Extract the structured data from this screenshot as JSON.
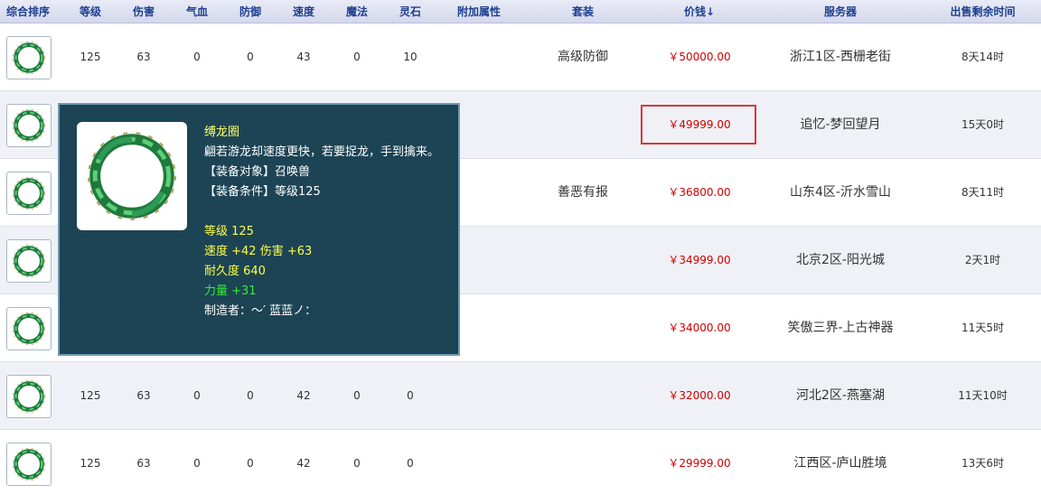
{
  "headers": {
    "sort": "综合排序",
    "level": "等级",
    "damage": "伤害",
    "hp": "气血",
    "defense": "防御",
    "speed": "速度",
    "magic": "魔法",
    "spirit": "灵石",
    "extra": "附加属性",
    "set": "套装",
    "price": "价钱↓",
    "server": "服务器",
    "time": "出售剩余时间"
  },
  "rows": [
    {
      "level": "125",
      "damage": "63",
      "hp": "0",
      "defense": "0",
      "speed": "43",
      "magic": "0",
      "spirit": "10",
      "extra": "",
      "set": "高级防御",
      "price": "￥50000.00",
      "server": "浙江1区-西栅老街",
      "time": "8天14时"
    },
    {
      "level": "",
      "damage": "",
      "hp": "",
      "defense": "",
      "speed": "",
      "magic": "",
      "spirit": "",
      "extra": "",
      "set": "",
      "price": "￥49999.00",
      "server": "追忆-梦回望月",
      "time": "15天0时"
    },
    {
      "level": "",
      "damage": "",
      "hp": "",
      "defense": "",
      "speed": "",
      "magic": "",
      "spirit": "",
      "extra": "",
      "set": "善恶有报",
      "price": "￥36800.00",
      "server": "山东4区-沂水雪山",
      "time": "8天11时"
    },
    {
      "level": "",
      "damage": "",
      "hp": "",
      "defense": "",
      "speed": "",
      "magic": "",
      "spirit": "",
      "extra": "",
      "set": "",
      "price": "￥34999.00",
      "server": "北京2区-阳光城",
      "time": "2天1时"
    },
    {
      "level": "",
      "damage": "",
      "hp": "",
      "defense": "",
      "speed": "",
      "magic": "",
      "spirit": "",
      "extra": "",
      "set": "",
      "price": "￥34000.00",
      "server": "笑傲三界-上古神器",
      "time": "11天5时"
    },
    {
      "level": "125",
      "damage": "63",
      "hp": "0",
      "defense": "0",
      "speed": "42",
      "magic": "0",
      "spirit": "0",
      "extra": "",
      "set": "",
      "price": "￥32000.00",
      "server": "河北2区-燕塞湖",
      "time": "11天10时"
    },
    {
      "level": "125",
      "damage": "63",
      "hp": "0",
      "defense": "0",
      "speed": "42",
      "magic": "0",
      "spirit": "0",
      "extra": "",
      "set": "",
      "price": "￥29999.00",
      "server": "江西区-庐山胜境",
      "time": "13天6时"
    }
  ],
  "tooltip": {
    "name": "缚龙圈",
    "desc": "翩若游龙却速度更快，若要捉龙，手到擒来。",
    "target": "【装备对象】召唤兽",
    "requirement": "【装备条件】等级125",
    "level": "等级 125",
    "stats": "速度 +42 伤害 +63",
    "durability": "耐久度 640",
    "bonus": "力量 +31",
    "maker": "制造者：～′ 蓝蓝ノ："
  },
  "icons": {
    "item": "jade-ring-icon"
  },
  "colors": {
    "price": "#d40000",
    "header_text": "#1d3f8f",
    "tooltip_bg": "#1d4455",
    "highlight": "#d9363b"
  }
}
